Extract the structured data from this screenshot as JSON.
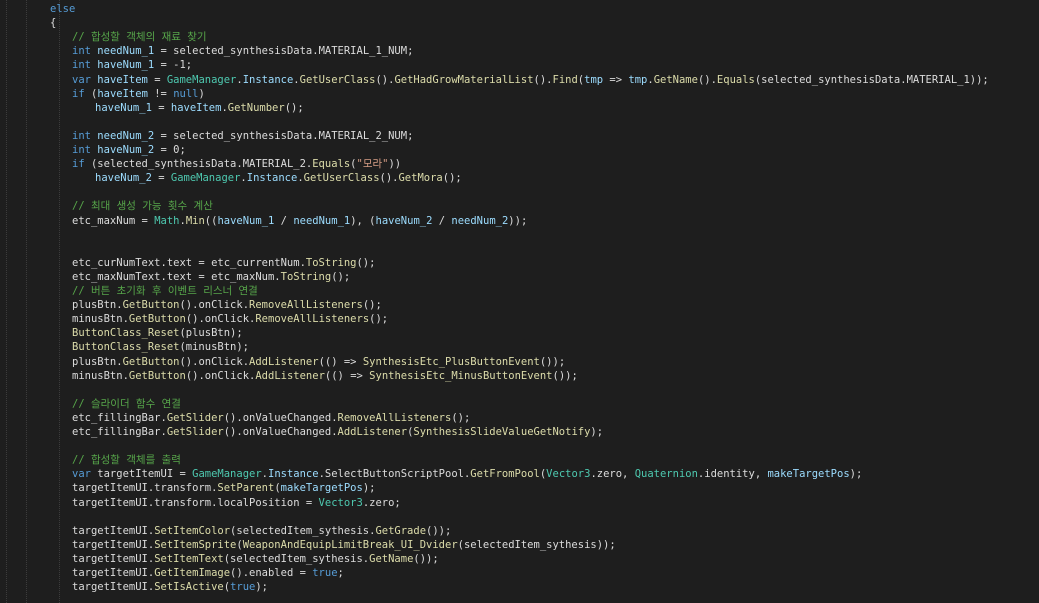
{
  "editor": {
    "lines": [
      {
        "indent": 0,
        "tokens": [
          [
            "kw",
            "else"
          ]
        ]
      },
      {
        "indent": 0,
        "tokens": [
          [
            "plain",
            "{"
          ]
        ]
      },
      {
        "indent": 1,
        "tokens": [
          [
            "cmt",
            "// 합성할 객체의 재료 찾기"
          ]
        ]
      },
      {
        "indent": 1,
        "tokens": [
          [
            "kw",
            "int"
          ],
          [
            "plain",
            " "
          ],
          [
            "var",
            "needNum_1"
          ],
          [
            "plain",
            " = selected_synthesisData.MATERIAL_1_NUM;"
          ]
        ]
      },
      {
        "indent": 1,
        "tokens": [
          [
            "kw",
            "int"
          ],
          [
            "plain",
            " "
          ],
          [
            "var",
            "haveNum_1"
          ],
          [
            "plain",
            " = -1;"
          ]
        ]
      },
      {
        "indent": 1,
        "tokens": [
          [
            "kw",
            "var"
          ],
          [
            "plain",
            " "
          ],
          [
            "var",
            "haveItem"
          ],
          [
            "plain",
            " = "
          ],
          [
            "type",
            "GameManager"
          ],
          [
            "plain",
            "."
          ],
          [
            "var",
            "Instance"
          ],
          [
            "plain",
            "."
          ],
          [
            "method",
            "GetUserClass"
          ],
          [
            "plain",
            "()."
          ],
          [
            "method",
            "GetHadGrowMaterialList"
          ],
          [
            "plain",
            "()."
          ],
          [
            "method",
            "Find"
          ],
          [
            "plain",
            "("
          ],
          [
            "var",
            "tmp"
          ],
          [
            "plain",
            " => "
          ],
          [
            "var",
            "tmp"
          ],
          [
            "plain",
            "."
          ],
          [
            "method",
            "GetName"
          ],
          [
            "plain",
            "()."
          ],
          [
            "method",
            "Equals"
          ],
          [
            "plain",
            "(selected_synthesisData.MATERIAL_1));"
          ]
        ]
      },
      {
        "indent": 1,
        "tokens": [
          [
            "kw",
            "if"
          ],
          [
            "plain",
            " ("
          ],
          [
            "var",
            "haveItem"
          ],
          [
            "plain",
            " != "
          ],
          [
            "kw",
            "null"
          ],
          [
            "plain",
            ")"
          ]
        ]
      },
      {
        "indent": 2,
        "tokens": [
          [
            "var",
            "haveNum_1"
          ],
          [
            "plain",
            " = "
          ],
          [
            "var",
            "haveItem"
          ],
          [
            "plain",
            "."
          ],
          [
            "method",
            "GetNumber"
          ],
          [
            "plain",
            "();"
          ]
        ]
      },
      {
        "indent": 0,
        "tokens": []
      },
      {
        "indent": 1,
        "tokens": [
          [
            "kw",
            "int"
          ],
          [
            "plain",
            " "
          ],
          [
            "var",
            "needNum_2"
          ],
          [
            "plain",
            " = selected_synthesisData.MATERIAL_2_NUM;"
          ]
        ]
      },
      {
        "indent": 1,
        "tokens": [
          [
            "kw",
            "int"
          ],
          [
            "plain",
            " "
          ],
          [
            "var",
            "haveNum_2"
          ],
          [
            "plain",
            " = 0;"
          ]
        ]
      },
      {
        "indent": 1,
        "tokens": [
          [
            "kw",
            "if"
          ],
          [
            "plain",
            " (selected_synthesisData.MATERIAL_2."
          ],
          [
            "method",
            "Equals"
          ],
          [
            "plain",
            "("
          ],
          [
            "str",
            "\"모라\""
          ],
          [
            "plain",
            "))"
          ]
        ]
      },
      {
        "indent": 2,
        "tokens": [
          [
            "var",
            "haveNum_2"
          ],
          [
            "plain",
            " = "
          ],
          [
            "type",
            "GameManager"
          ],
          [
            "plain",
            "."
          ],
          [
            "var",
            "Instance"
          ],
          [
            "plain",
            "."
          ],
          [
            "method",
            "GetUserClass"
          ],
          [
            "plain",
            "()."
          ],
          [
            "method",
            "GetMora"
          ],
          [
            "plain",
            "();"
          ]
        ]
      },
      {
        "indent": 0,
        "tokens": []
      },
      {
        "indent": 1,
        "tokens": [
          [
            "cmt",
            "// 최대 생성 가능 횟수 계산"
          ]
        ]
      },
      {
        "indent": 1,
        "tokens": [
          [
            "plain",
            "etc_maxNum = "
          ],
          [
            "type",
            "Math"
          ],
          [
            "plain",
            "."
          ],
          [
            "method",
            "Min"
          ],
          [
            "plain",
            "(("
          ],
          [
            "var",
            "haveNum_1"
          ],
          [
            "plain",
            " / "
          ],
          [
            "var",
            "needNum_1"
          ],
          [
            "plain",
            "), ("
          ],
          [
            "var",
            "haveNum_2"
          ],
          [
            "plain",
            " / "
          ],
          [
            "var",
            "needNum_2"
          ],
          [
            "plain",
            "));"
          ]
        ]
      },
      {
        "indent": 0,
        "tokens": []
      },
      {
        "indent": 0,
        "tokens": []
      },
      {
        "indent": 1,
        "tokens": [
          [
            "plain",
            "etc_curNumText.text = etc_currentNum."
          ],
          [
            "method",
            "ToString"
          ],
          [
            "plain",
            "();"
          ]
        ]
      },
      {
        "indent": 1,
        "tokens": [
          [
            "plain",
            "etc_maxNumText.text = etc_maxNum."
          ],
          [
            "method",
            "ToString"
          ],
          [
            "plain",
            "();"
          ]
        ]
      },
      {
        "indent": 1,
        "tokens": [
          [
            "cmt",
            "// 버튼 초기화 후 이벤트 리스너 연결"
          ]
        ]
      },
      {
        "indent": 1,
        "tokens": [
          [
            "plain",
            "plusBtn."
          ],
          [
            "method",
            "GetButton"
          ],
          [
            "plain",
            "().onClick."
          ],
          [
            "method",
            "RemoveAllListeners"
          ],
          [
            "plain",
            "();"
          ]
        ]
      },
      {
        "indent": 1,
        "tokens": [
          [
            "plain",
            "minusBtn."
          ],
          [
            "method",
            "GetButton"
          ],
          [
            "plain",
            "().onClick."
          ],
          [
            "method",
            "RemoveAllListeners"
          ],
          [
            "plain",
            "();"
          ]
        ]
      },
      {
        "indent": 1,
        "tokens": [
          [
            "method",
            "ButtonClass_Reset"
          ],
          [
            "plain",
            "(plusBtn);"
          ]
        ]
      },
      {
        "indent": 1,
        "tokens": [
          [
            "method",
            "ButtonClass_Reset"
          ],
          [
            "plain",
            "(minusBtn);"
          ]
        ]
      },
      {
        "indent": 1,
        "tokens": [
          [
            "plain",
            "plusBtn."
          ],
          [
            "method",
            "GetButton"
          ],
          [
            "plain",
            "().onClick."
          ],
          [
            "method",
            "AddListener"
          ],
          [
            "plain",
            "(() => "
          ],
          [
            "method",
            "SynthesisEtc_PlusButtonEvent"
          ],
          [
            "plain",
            "());"
          ]
        ]
      },
      {
        "indent": 1,
        "tokens": [
          [
            "plain",
            "minusBtn."
          ],
          [
            "method",
            "GetButton"
          ],
          [
            "plain",
            "().onClick."
          ],
          [
            "method",
            "AddListener"
          ],
          [
            "plain",
            "(() => "
          ],
          [
            "method",
            "SynthesisEtc_MinusButtonEvent"
          ],
          [
            "plain",
            "());"
          ]
        ]
      },
      {
        "indent": 0,
        "tokens": []
      },
      {
        "indent": 1,
        "tokens": [
          [
            "cmt",
            "// 슬라이더 함수 연결"
          ]
        ]
      },
      {
        "indent": 1,
        "tokens": [
          [
            "plain",
            "etc_fillingBar."
          ],
          [
            "method",
            "GetSlider"
          ],
          [
            "plain",
            "().onValueChanged."
          ],
          [
            "method",
            "RemoveAllListeners"
          ],
          [
            "plain",
            "();"
          ]
        ]
      },
      {
        "indent": 1,
        "tokens": [
          [
            "plain",
            "etc_fillingBar."
          ],
          [
            "method",
            "GetSlider"
          ],
          [
            "plain",
            "().onValueChanged."
          ],
          [
            "method",
            "AddListener"
          ],
          [
            "plain",
            "("
          ],
          [
            "method",
            "SynthesisSlideValueGetNotify"
          ],
          [
            "plain",
            ");"
          ]
        ]
      },
      {
        "indent": 0,
        "tokens": []
      },
      {
        "indent": 1,
        "tokens": [
          [
            "cmt",
            "// 합성할 객체를 출력"
          ]
        ]
      },
      {
        "indent": 1,
        "tokens": [
          [
            "kw",
            "var"
          ],
          [
            "plain",
            " targetItemUI = "
          ],
          [
            "type",
            "GameManager"
          ],
          [
            "plain",
            "."
          ],
          [
            "var",
            "Instance"
          ],
          [
            "plain",
            ".SelectButtonScriptPool."
          ],
          [
            "method",
            "GetFromPool"
          ],
          [
            "plain",
            "("
          ],
          [
            "type",
            "Vector3"
          ],
          [
            "plain",
            ".zero, "
          ],
          [
            "type",
            "Quaternion"
          ],
          [
            "plain",
            ".identity, "
          ],
          [
            "var",
            "makeTargetPos"
          ],
          [
            "plain",
            ");"
          ]
        ]
      },
      {
        "indent": 1,
        "tokens": [
          [
            "plain",
            "targetItemUI.transform."
          ],
          [
            "method",
            "SetParent"
          ],
          [
            "plain",
            "("
          ],
          [
            "var",
            "makeTargetPos"
          ],
          [
            "plain",
            ");"
          ]
        ]
      },
      {
        "indent": 1,
        "tokens": [
          [
            "plain",
            "targetItemUI.transform.localPosition = "
          ],
          [
            "type",
            "Vector3"
          ],
          [
            "plain",
            ".zero;"
          ]
        ]
      },
      {
        "indent": 0,
        "tokens": []
      },
      {
        "indent": 1,
        "tokens": [
          [
            "plain",
            "targetItemUI."
          ],
          [
            "method",
            "SetItemColor"
          ],
          [
            "plain",
            "(selectedItem_sythesis."
          ],
          [
            "method",
            "GetGrade"
          ],
          [
            "plain",
            "());"
          ]
        ]
      },
      {
        "indent": 1,
        "tokens": [
          [
            "plain",
            "targetItemUI."
          ],
          [
            "method",
            "SetItemSprite"
          ],
          [
            "plain",
            "("
          ],
          [
            "method",
            "WeaponAndEquipLimitBreak_UI_Dvider"
          ],
          [
            "plain",
            "(selectedItem_sythesis));"
          ]
        ]
      },
      {
        "indent": 1,
        "tokens": [
          [
            "plain",
            "targetItemUI."
          ],
          [
            "method",
            "SetItemText"
          ],
          [
            "plain",
            "(selectedItem_sythesis."
          ],
          [
            "method",
            "GetName"
          ],
          [
            "plain",
            "());"
          ]
        ]
      },
      {
        "indent": 1,
        "tokens": [
          [
            "plain",
            "targetItemUI."
          ],
          [
            "method",
            "GetItemImage"
          ],
          [
            "plain",
            "().enabled = "
          ],
          [
            "kw",
            "true"
          ],
          [
            "plain",
            ";"
          ]
        ]
      },
      {
        "indent": 1,
        "tokens": [
          [
            "plain",
            "targetItemUI."
          ],
          [
            "method",
            "SetIsActive"
          ],
          [
            "plain",
            "("
          ],
          [
            "kw",
            "true"
          ],
          [
            "plain",
            ");"
          ]
        ]
      }
    ]
  }
}
